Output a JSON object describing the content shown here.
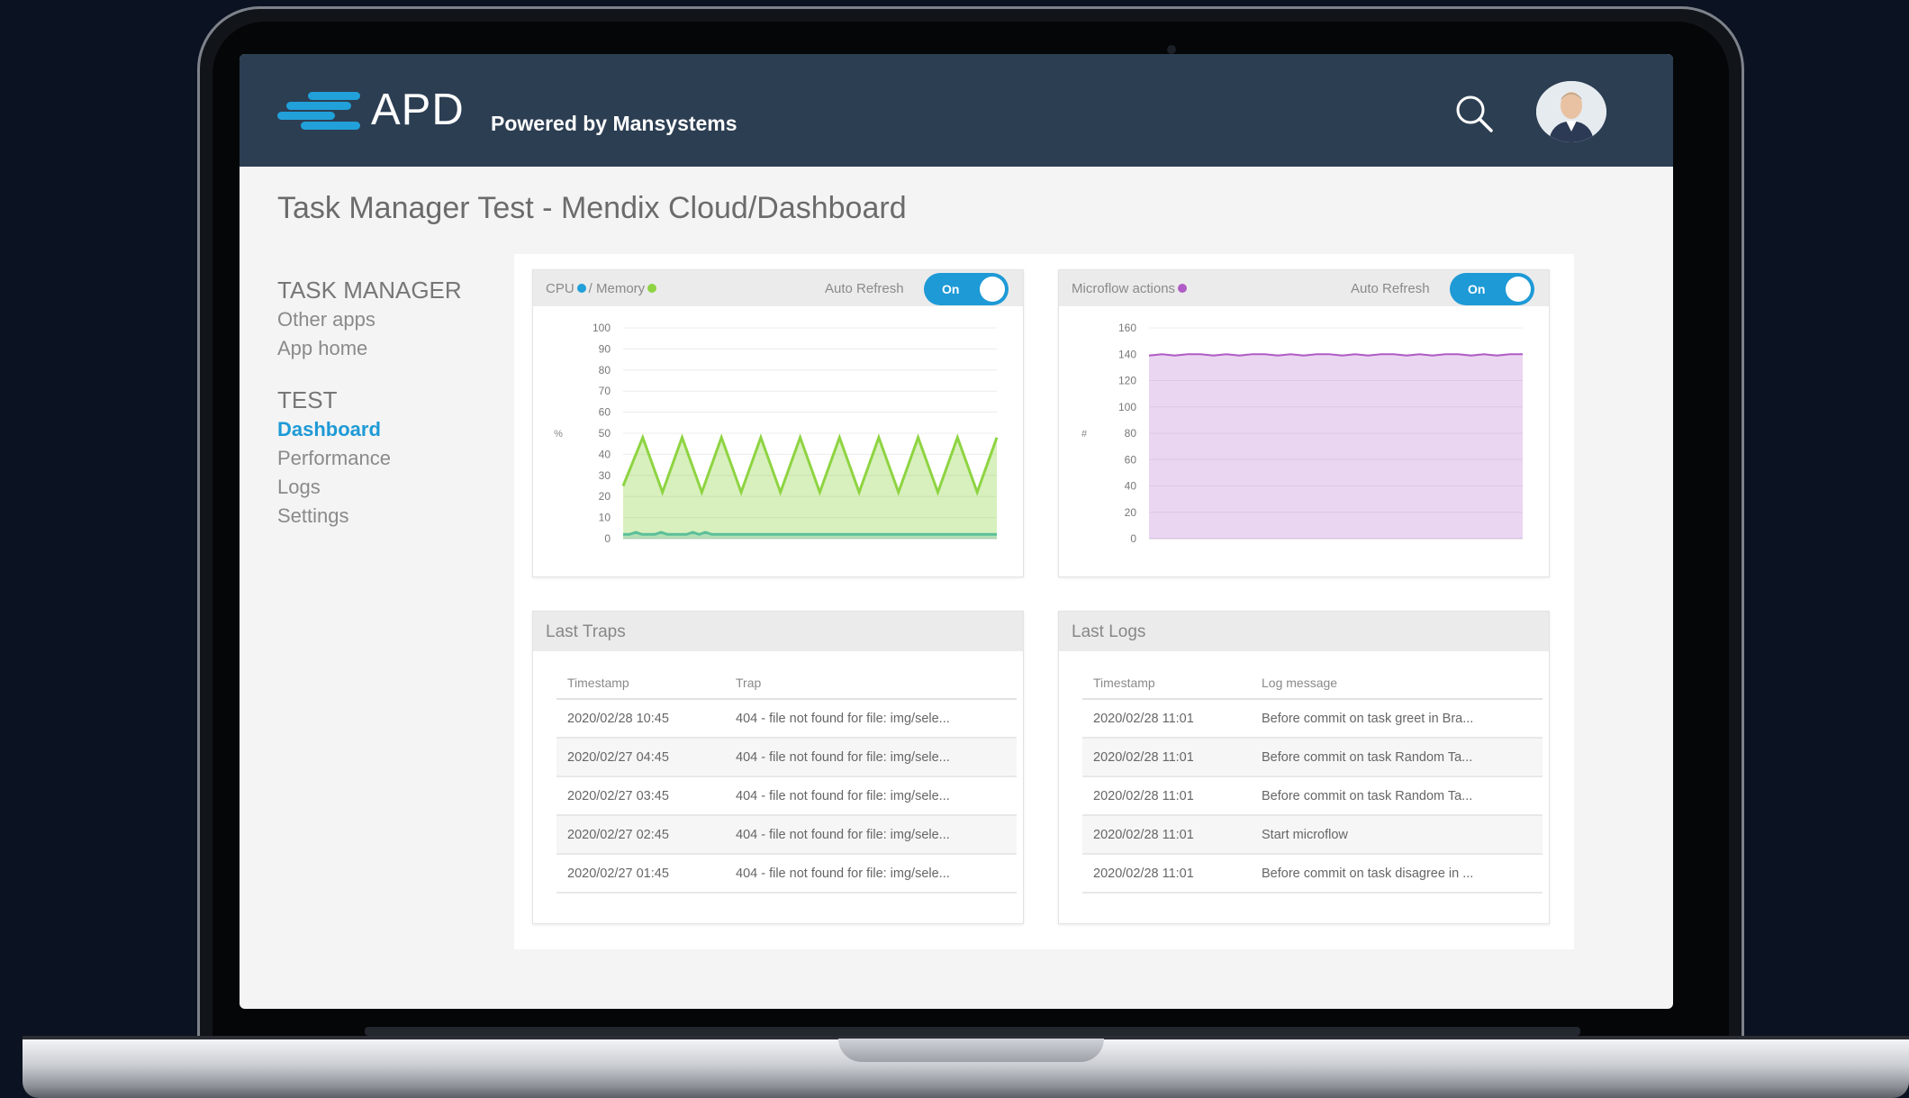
{
  "header": {
    "brand": "APD",
    "tagline": "Powered by Mansystems",
    "search_icon": "search-icon",
    "avatar_icon": "user-avatar"
  },
  "page_title": "Task Manager Test - Mendix Cloud/Dashboard",
  "nav": {
    "section1": "TASK MANAGER",
    "items1": [
      "Other apps",
      "App home"
    ],
    "section2": "TEST",
    "items2": [
      "Dashboard",
      "Performance",
      "Logs",
      "Settings"
    ],
    "active": "Dashboard"
  },
  "colors": {
    "accent": "#1e9ad6",
    "header_bg": "#2c3e52",
    "cpu": "#21a0d9",
    "memory": "#8ed442",
    "microflow": "#b05cc6"
  },
  "cpu_chart": {
    "label_cpu": "CPU",
    "label_sep": "/ Memory",
    "auto_refresh": "Auto Refresh",
    "toggle": "On",
    "ylabel": "%",
    "chart_data": {
      "type": "area",
      "ylim": [
        0,
        100
      ],
      "yticks": [
        "100",
        "90",
        "80",
        "70",
        "60",
        "50",
        "40",
        "30",
        "20",
        "10",
        "0"
      ],
      "series": [
        {
          "name": "CPU",
          "values": [
            2,
            2,
            3,
            2,
            2,
            2,
            3,
            2,
            2,
            2,
            2,
            3,
            2,
            3,
            2,
            2,
            2,
            2,
            2,
            2,
            2,
            2,
            2,
            2,
            2,
            2,
            2,
            2,
            2,
            2,
            2,
            2,
            2,
            2,
            2,
            2,
            2,
            2,
            2,
            2,
            2,
            2,
            2,
            2,
            2,
            2,
            2,
            2,
            2,
            2,
            2,
            2,
            2,
            2,
            2,
            2,
            2,
            2,
            2,
            2
          ]
        },
        {
          "name": "Memory",
          "values": [
            25,
            48,
            22,
            48,
            22,
            48,
            22,
            48,
            22,
            48,
            22,
            48,
            22,
            48,
            22,
            48,
            22,
            48,
            22,
            48
          ]
        }
      ]
    }
  },
  "microflow_chart": {
    "label": "Microflow actions",
    "auto_refresh": "Auto Refresh",
    "toggle": "On",
    "ylabel": "#",
    "chart_data": {
      "type": "area",
      "ylim": [
        0,
        160
      ],
      "yticks": [
        "160",
        "140",
        "120",
        "100",
        "80",
        "60",
        "40",
        "20",
        "0"
      ],
      "series": [
        {
          "name": "Microflow actions",
          "values": [
            139,
            140,
            139,
            140,
            140,
            139,
            140,
            139,
            140,
            140,
            139,
            140,
            139,
            140,
            140,
            139,
            140,
            139,
            140,
            140,
            139,
            140,
            139,
            140,
            140,
            139,
            140,
            139,
            140,
            140
          ]
        }
      ]
    }
  },
  "traps": {
    "title": "Last Traps",
    "columns": [
      "Timestamp",
      "Trap"
    ],
    "rows": [
      [
        "2020/02/28 10:45",
        "404 - file not found for file: img/sele..."
      ],
      [
        "2020/02/27 04:45",
        "404 - file not found for file: img/sele..."
      ],
      [
        "2020/02/27 03:45",
        "404 - file not found for file: img/sele..."
      ],
      [
        "2020/02/27 02:45",
        "404 - file not found for file: img/sele..."
      ],
      [
        "2020/02/27 01:45",
        "404 - file not found for file: img/sele..."
      ]
    ]
  },
  "logs": {
    "title": "Last Logs",
    "columns": [
      "Timestamp",
      "Log message"
    ],
    "rows": [
      [
        "2020/02/28 11:01",
        "Before commit on task greet in Bra..."
      ],
      [
        "2020/02/28 11:01",
        "Before commit on task Random Ta..."
      ],
      [
        "2020/02/28 11:01",
        "Before commit on task Random Ta..."
      ],
      [
        "2020/02/28 11:01",
        "Start microflow"
      ],
      [
        "2020/02/28 11:01",
        "Before commit on task disagree in ..."
      ]
    ]
  }
}
